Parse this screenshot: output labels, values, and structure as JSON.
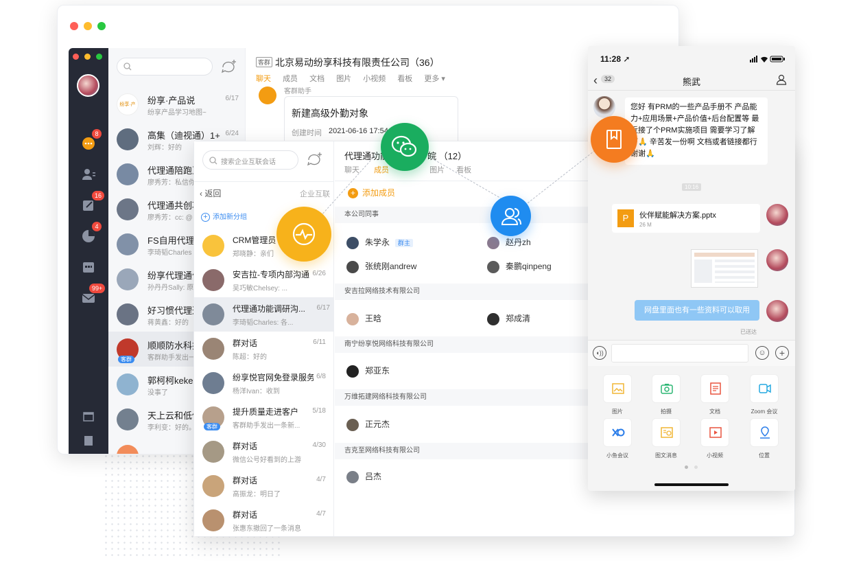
{
  "back_window": {
    "traffic_colors": [
      "#ff5f57",
      "#febc2e",
      "#28c840"
    ],
    "nav_badges": [
      "8",
      "16",
      "4",
      "99+"
    ],
    "conversations": [
      {
        "name": "纷享·产品说",
        "sub": "纷享产品学习地图~",
        "date": "6/17",
        "avatar_text": "纷享·产品说"
      },
      {
        "name": "高集（迪视通）1+",
        "sub": "刘辉：好的",
        "date": "6/24"
      },
      {
        "name": "代理通陪跑互",
        "sub": "廖秀芳：私信你"
      },
      {
        "name": "代理通共创项",
        "sub": "廖秀芳：cc: @"
      },
      {
        "name": "FS自用代理通",
        "sub": "李琦韬Charles"
      },
      {
        "name": "纷享代理通价",
        "sub": "孙丹丹Sally: 原"
      },
      {
        "name": "好习惯代理通",
        "sub": "蒋黄鑫：好的"
      },
      {
        "name": "顺顺防水科技",
        "sub": "客群助手发出一",
        "tag": "客群"
      },
      {
        "name": "郭柯柯kekeg",
        "sub": "没事了"
      },
      {
        "name": "天上云和低佢",
        "sub": "李利变：好的。"
      }
    ],
    "chat": {
      "tag": "客群",
      "title": "北京易动纷享科技有限责任公司（36）",
      "tabs": [
        "聊天",
        "成员",
        "文档",
        "图片",
        "小视频",
        "看板",
        "更多 ▾"
      ],
      "bot_name": "客群助手",
      "card_title": "新建高级外勤对象",
      "card_time_label": "创建时间",
      "card_time": "2021-06-16 17:54"
    }
  },
  "middle_window": {
    "search_placeholder": "搜索企业互联会话",
    "back_label": "返回",
    "header_right": "企业互联",
    "add_group": "添加新分组",
    "conversations": [
      {
        "name": "CRM管理员",
        "sub": "郑晓静：亲们",
        "date": ""
      },
      {
        "name": "安吉拉-专项内部沟通",
        "sub": "吴巧敏Chelsey: ...",
        "date": "6/26"
      },
      {
        "name": "代理通功能调研沟...",
        "sub": "李琦韬Charles: 各...",
        "date": "6/17"
      },
      {
        "name": "群对话",
        "sub": "陈超：好的",
        "date": "6/11"
      },
      {
        "name": "纷享悦官网免登录服务群",
        "sub": "杨洋Ivan：收到",
        "date": "6/8"
      },
      {
        "name": "提升质量走进客户",
        "sub": "客群助手发出一条新...",
        "date": "5/18",
        "tag": "客群"
      },
      {
        "name": "群对话",
        "sub": "微信公号好看到的上游",
        "date": "4/30"
      },
      {
        "name": "群对话",
        "sub": "高振龙：明日了",
        "date": "4/7"
      },
      {
        "name": "群对话",
        "sub": "张惠东撤回了一条消息",
        "date": "4/7"
      }
    ],
    "chat_title_a": "代理通功能",
    "chat_title_b": "皖 （12）",
    "tabs": [
      "聊天",
      "成员",
      "文档",
      "图片",
      "看板"
    ],
    "add_member": "添加成员",
    "sections": [
      {
        "title": "本公司同事",
        "members": [
          "朱学永",
          "赵丹zh",
          "张统刚andrew",
          "秦鹏qinpeng"
        ],
        "owner_tag": "群主"
      },
      {
        "title": "安吉拉网络技术有限公司",
        "members": [
          "王晗",
          "郑成清"
        ]
      },
      {
        "title": "南宁纷享悦网络科技有限公司",
        "members": [
          "郑亚东"
        ]
      },
      {
        "title": "万维拓建网络科技有限公司",
        "members": [
          "正元杰"
        ]
      },
      {
        "title": "吉克至网络科技有限公司",
        "members": [
          "吕杰"
        ]
      }
    ]
  },
  "phone": {
    "time": "11:28 ➚",
    "back_count": "32",
    "title": "熊武",
    "incoming": "您好 有PRM的一些产品手册不 产品能力+应用场景+产品价值+后台配置等 最近接了个PRM实施项目 需要学习了解下🙏 辛苦发一份啊 文档或者链接都行 谢谢🙏",
    "time_divider": "10:16",
    "file_name": "伙伴赋能解决方案.pptx",
    "file_size": "26 M",
    "file_icon": "P",
    "outgoing": "网盘里面也有一些资料可以取用",
    "delivered": "已送达",
    "tools": [
      "图片",
      "拍摄",
      "文档",
      "Zoom 会议",
      "小鱼会议",
      "图文消息",
      "小视频",
      "位置"
    ]
  },
  "colors": {
    "accent_orange": "#f39c12",
    "wechat_green": "#1aad5f",
    "blue": "#1f8cf0",
    "bubble_blue": "#8fc7f5",
    "dark_nav": "#262a36"
  }
}
